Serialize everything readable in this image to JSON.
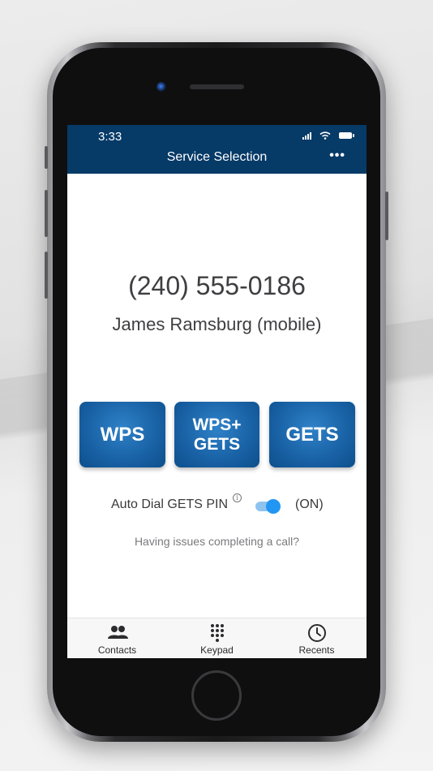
{
  "status_bar": {
    "time": "3:33"
  },
  "header": {
    "title": "Service Selection",
    "more_label": "•••"
  },
  "call": {
    "number": "(240) 555-0186",
    "contact": "James Ramsburg (mobile)"
  },
  "services": {
    "wps": "WPS",
    "wps_gets_line1": "WPS+",
    "wps_gets_line2": "GETS",
    "gets": "GETS"
  },
  "auto_dial": {
    "label": "Auto Dial GETS PIN",
    "state": "(ON)",
    "info": "i",
    "enabled": true
  },
  "help_link": "Having issues completing a call?",
  "tabs": [
    {
      "label": "Contacts",
      "icon": "contacts-icon"
    },
    {
      "label": "Keypad",
      "icon": "keypad-icon"
    },
    {
      "label": "Recents",
      "icon": "recents-icon"
    }
  ],
  "colors": {
    "header": "#063a67",
    "button": "#1a63a7",
    "toggle": "#2196f3"
  }
}
